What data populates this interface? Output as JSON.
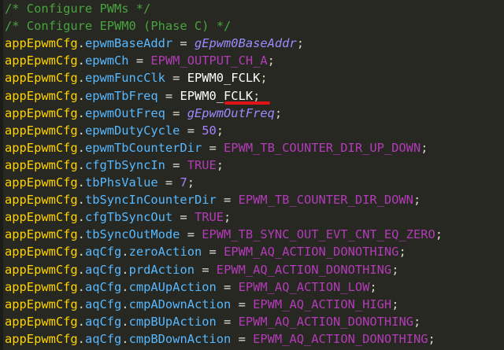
{
  "editor": {
    "lines": [
      {
        "tokens": [
          {
            "t": "comment",
            "v": "/* Configure PWMs */"
          }
        ]
      },
      {
        "tokens": [
          {
            "t": "comment",
            "v": "/* Configure EPWM0 (Phase C) */"
          }
        ]
      },
      {
        "tokens": [
          {
            "t": "var",
            "v": "appEpwmCfg"
          },
          {
            "t": "dot",
            "v": "."
          },
          {
            "t": "member",
            "v": "epwmBaseAddr"
          },
          {
            "t": "op",
            "v": " = "
          },
          {
            "t": "global",
            "v": "gEpwm0BaseAddr"
          },
          {
            "t": "semi",
            "v": ";"
          }
        ]
      },
      {
        "tokens": [
          {
            "t": "var",
            "v": "appEpwmCfg"
          },
          {
            "t": "dot",
            "v": "."
          },
          {
            "t": "member",
            "v": "epwmCh"
          },
          {
            "t": "op",
            "v": " = "
          },
          {
            "t": "const",
            "v": "EPWM_OUTPUT_CH_A"
          },
          {
            "t": "semi",
            "v": ";"
          }
        ]
      },
      {
        "tokens": [
          {
            "t": "var",
            "v": "appEpwmCfg"
          },
          {
            "t": "dot",
            "v": "."
          },
          {
            "t": "member",
            "v": "epwmFuncClk"
          },
          {
            "t": "op",
            "v": " = "
          },
          {
            "t": "ident",
            "v": "EPWM0_FCLK"
          },
          {
            "t": "semi",
            "v": ";"
          }
        ]
      },
      {
        "tokens": [
          {
            "t": "var",
            "v": "appEpwmCfg"
          },
          {
            "t": "dot",
            "v": "."
          },
          {
            "t": "member",
            "v": "epwmTbFreq"
          },
          {
            "t": "op",
            "v": " = "
          },
          {
            "t": "ident",
            "v": "EPWM0_FCLK"
          },
          {
            "t": "semi",
            "v": ";"
          }
        ]
      },
      {
        "tokens": [
          {
            "t": "var",
            "v": "appEpwmCfg"
          },
          {
            "t": "dot",
            "v": "."
          },
          {
            "t": "member",
            "v": "epwmOutFreq"
          },
          {
            "t": "op",
            "v": " = "
          },
          {
            "t": "global",
            "v": "gEpwmOutFreq"
          },
          {
            "t": "semi",
            "v": ";"
          }
        ]
      },
      {
        "tokens": [
          {
            "t": "var",
            "v": "appEpwmCfg"
          },
          {
            "t": "dot",
            "v": "."
          },
          {
            "t": "member",
            "v": "epwmDutyCycle"
          },
          {
            "t": "op",
            "v": " = "
          },
          {
            "t": "num",
            "v": "50"
          },
          {
            "t": "semi",
            "v": ";"
          }
        ]
      },
      {
        "tokens": [
          {
            "t": "var",
            "v": "appEpwmCfg"
          },
          {
            "t": "dot",
            "v": "."
          },
          {
            "t": "member",
            "v": "epwmTbCounterDir"
          },
          {
            "t": "op",
            "v": " = "
          },
          {
            "t": "const",
            "v": "EPWM_TB_COUNTER_DIR_UP_DOWN"
          },
          {
            "t": "semi",
            "v": ";"
          }
        ]
      },
      {
        "tokens": [
          {
            "t": "var",
            "v": "appEpwmCfg"
          },
          {
            "t": "dot",
            "v": "."
          },
          {
            "t": "member",
            "v": "cfgTbSyncIn"
          },
          {
            "t": "op",
            "v": " = "
          },
          {
            "t": "bool",
            "v": "TRUE"
          },
          {
            "t": "semi",
            "v": ";"
          }
        ]
      },
      {
        "tokens": [
          {
            "t": "var",
            "v": "appEpwmCfg"
          },
          {
            "t": "dot",
            "v": "."
          },
          {
            "t": "member",
            "v": "tbPhsValue"
          },
          {
            "t": "op",
            "v": " = "
          },
          {
            "t": "num",
            "v": "7"
          },
          {
            "t": "semi",
            "v": ";"
          }
        ]
      },
      {
        "tokens": [
          {
            "t": "var",
            "v": "appEpwmCfg"
          },
          {
            "t": "dot",
            "v": "."
          },
          {
            "t": "member",
            "v": "tbSyncInCounterDir"
          },
          {
            "t": "op",
            "v": " = "
          },
          {
            "t": "const",
            "v": "EPWM_TB_COUNTER_DIR_DOWN"
          },
          {
            "t": "semi",
            "v": ";"
          }
        ]
      },
      {
        "tokens": [
          {
            "t": "var",
            "v": "appEpwmCfg"
          },
          {
            "t": "dot",
            "v": "."
          },
          {
            "t": "member",
            "v": "cfgTbSyncOut"
          },
          {
            "t": "op",
            "v": " = "
          },
          {
            "t": "bool",
            "v": "TRUE"
          },
          {
            "t": "semi",
            "v": ";"
          }
        ]
      },
      {
        "tokens": [
          {
            "t": "var",
            "v": "appEpwmCfg"
          },
          {
            "t": "dot",
            "v": "."
          },
          {
            "t": "member",
            "v": "tbSyncOutMode"
          },
          {
            "t": "op",
            "v": " = "
          },
          {
            "t": "const",
            "v": "EPWM_TB_SYNC_OUT_EVT_CNT_EQ_ZERO"
          },
          {
            "t": "semi",
            "v": ";"
          }
        ]
      },
      {
        "tokens": [
          {
            "t": "var",
            "v": "appEpwmCfg"
          },
          {
            "t": "dot",
            "v": "."
          },
          {
            "t": "member",
            "v": "aqCfg"
          },
          {
            "t": "dot",
            "v": "."
          },
          {
            "t": "member",
            "v": "zeroAction"
          },
          {
            "t": "op",
            "v": " = "
          },
          {
            "t": "const",
            "v": "EPWM_AQ_ACTION_DONOTHING"
          },
          {
            "t": "semi",
            "v": ";"
          }
        ]
      },
      {
        "tokens": [
          {
            "t": "var",
            "v": "appEpwmCfg"
          },
          {
            "t": "dot",
            "v": "."
          },
          {
            "t": "member",
            "v": "aqCfg"
          },
          {
            "t": "dot",
            "v": "."
          },
          {
            "t": "member",
            "v": "prdAction"
          },
          {
            "t": "op",
            "v": " = "
          },
          {
            "t": "const",
            "v": "EPWM_AQ_ACTION_DONOTHING"
          },
          {
            "t": "semi",
            "v": ";"
          }
        ]
      },
      {
        "tokens": [
          {
            "t": "var",
            "v": "appEpwmCfg"
          },
          {
            "t": "dot",
            "v": "."
          },
          {
            "t": "member",
            "v": "aqCfg"
          },
          {
            "t": "dot",
            "v": "."
          },
          {
            "t": "member",
            "v": "cmpAUpAction"
          },
          {
            "t": "op",
            "v": " = "
          },
          {
            "t": "const",
            "v": "EPWM_AQ_ACTION_LOW"
          },
          {
            "t": "semi",
            "v": ";"
          }
        ]
      },
      {
        "tokens": [
          {
            "t": "var",
            "v": "appEpwmCfg"
          },
          {
            "t": "dot",
            "v": "."
          },
          {
            "t": "member",
            "v": "aqCfg"
          },
          {
            "t": "dot",
            "v": "."
          },
          {
            "t": "member",
            "v": "cmpADownAction"
          },
          {
            "t": "op",
            "v": " = "
          },
          {
            "t": "const",
            "v": "EPWM_AQ_ACTION_HIGH"
          },
          {
            "t": "semi",
            "v": ";"
          }
        ]
      },
      {
        "tokens": [
          {
            "t": "var",
            "v": "appEpwmCfg"
          },
          {
            "t": "dot",
            "v": "."
          },
          {
            "t": "member",
            "v": "aqCfg"
          },
          {
            "t": "dot",
            "v": "."
          },
          {
            "t": "member",
            "v": "cmpBUpAction"
          },
          {
            "t": "op",
            "v": " = "
          },
          {
            "t": "const",
            "v": "EPWM_AQ_ACTION_DONOTHING"
          },
          {
            "t": "semi",
            "v": ";"
          }
        ]
      },
      {
        "tokens": [
          {
            "t": "var",
            "v": "appEpwmCfg"
          },
          {
            "t": "dot",
            "v": "."
          },
          {
            "t": "member",
            "v": "aqCfg"
          },
          {
            "t": "dot",
            "v": "."
          },
          {
            "t": "member",
            "v": "cmpBDownAction"
          },
          {
            "t": "op",
            "v": " = "
          },
          {
            "t": "const",
            "v": "EPWM_AQ_ACTION_DONOTHING"
          },
          {
            "t": "semi",
            "v": ";"
          }
        ]
      }
    ],
    "annotation": "red-underline-annotation"
  }
}
